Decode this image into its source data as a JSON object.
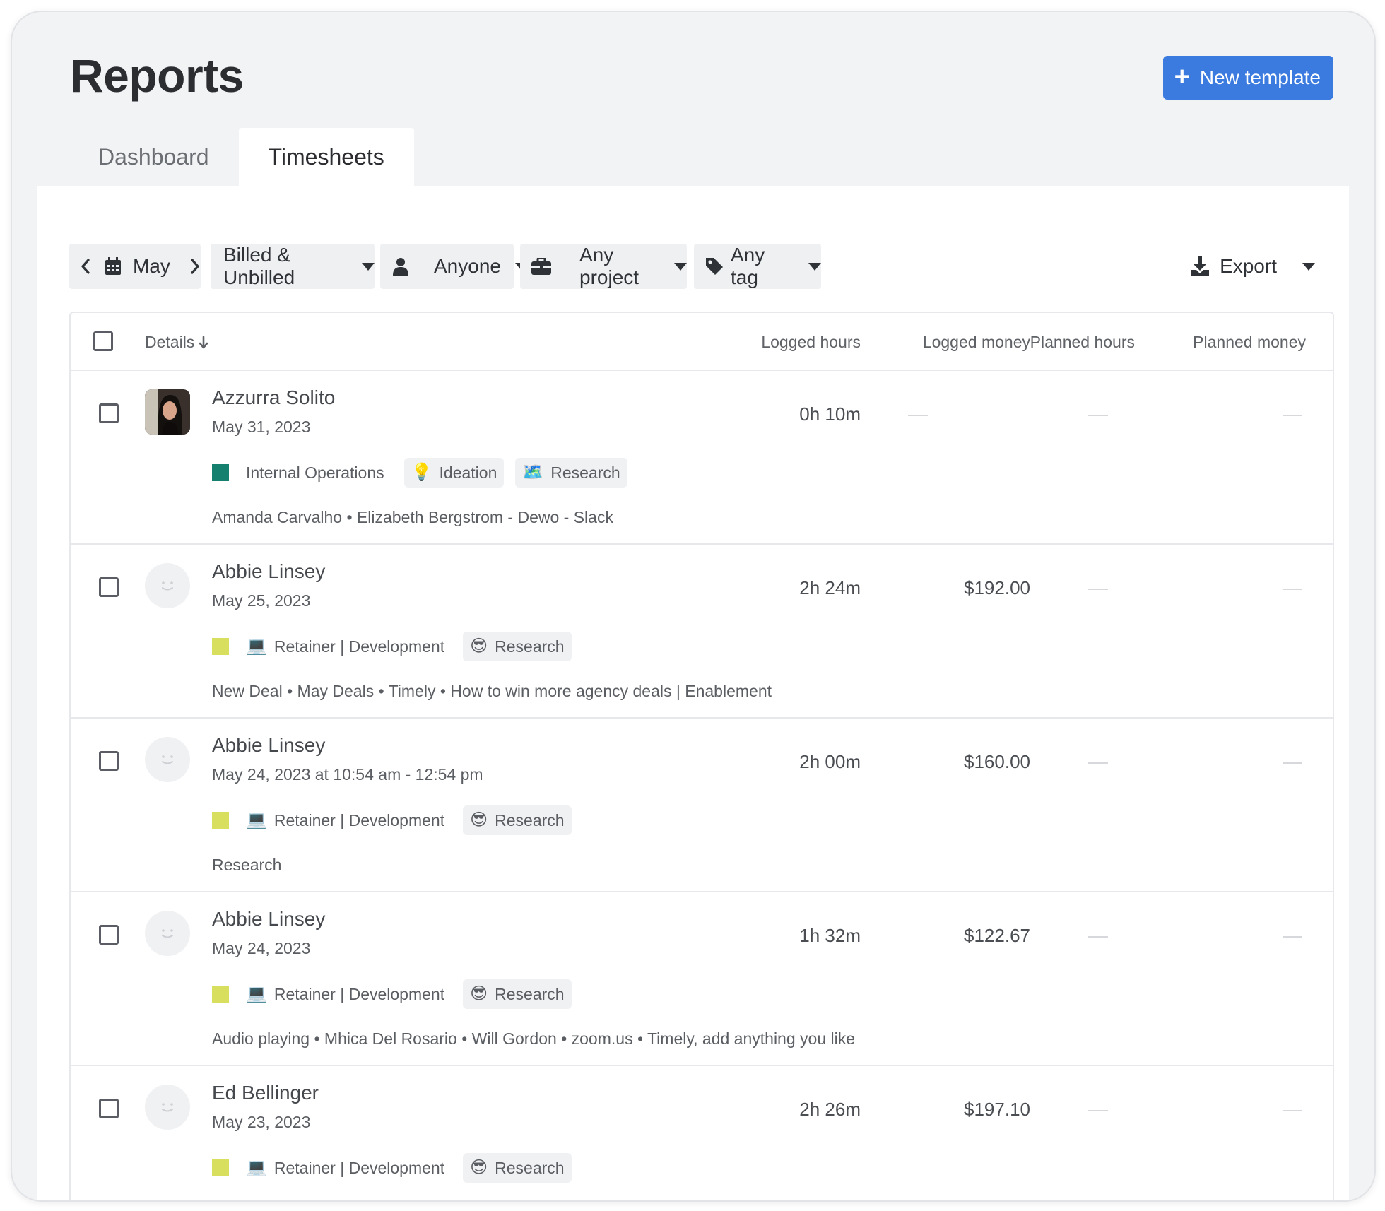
{
  "page": {
    "title": "Reports",
    "new_template_label": "New template"
  },
  "tabs": [
    {
      "label": "Dashboard",
      "active": false
    },
    {
      "label": "Timesheets",
      "active": true
    }
  ],
  "filters": {
    "period": "May",
    "billing": "Billed & Unbilled",
    "person": "Anyone",
    "project": "Any project",
    "tag": "Any tag",
    "export_label": "Export"
  },
  "table": {
    "columns": {
      "details": "Details",
      "logged_hours": "Logged hours",
      "logged_money": "Logged money",
      "planned_hours": "Planned hours",
      "planned_money": "Planned money"
    },
    "rows": [
      {
        "name": "Azzurra Solito",
        "date": "May 31, 2023",
        "logged_hours": "0h 10m",
        "logged_money": "",
        "project": "Internal Operations",
        "project_color": "#16806f",
        "tags": [
          {
            "icon": "lightbulb-icon",
            "label": "Ideation"
          },
          {
            "icon": "map-icon",
            "label": "Research"
          }
        ],
        "description": "Amanda Carvalho • Elizabeth Bergstrom - Dewo - Slack"
      },
      {
        "name": "Abbie Linsey",
        "date": "May 25, 2023",
        "logged_hours": "2h 24m",
        "logged_money": "$192.00",
        "project": "Retainer | Development",
        "project_color": "#d8df5f",
        "tags": [
          {
            "icon": "sunglasses-face-icon",
            "label": "Research"
          }
        ],
        "description": "New Deal • May Deals • Timely • How to win more agency deals | Enablement"
      },
      {
        "name": "Abbie Linsey",
        "date": "May 24, 2023 at 10:54 am - 12:54 pm",
        "logged_hours": "2h 00m",
        "logged_money": "$160.00",
        "project": "Retainer | Development",
        "project_color": "#d8df5f",
        "tags": [
          {
            "icon": "sunglasses-face-icon",
            "label": "Research"
          }
        ],
        "description": "Research"
      },
      {
        "name": "Abbie Linsey",
        "date": "May 24, 2023",
        "logged_hours": "1h 32m",
        "logged_money": "$122.67",
        "project": "Retainer | Development",
        "project_color": "#d8df5f",
        "tags": [
          {
            "icon": "sunglasses-face-icon",
            "label": "Research"
          }
        ],
        "description": "Audio playing • Mhica Del Rosario • Will Gordon • zoom.us • Timely, add anything you like"
      },
      {
        "name": "Ed Bellinger",
        "date": "May 23, 2023",
        "logged_hours": "2h 26m",
        "logged_money": "$197.10",
        "project": "Retainer | Development",
        "project_color": "#d8df5f",
        "tags": [
          {
            "icon": "sunglasses-face-icon",
            "label": "Research"
          }
        ],
        "description": ""
      }
    ]
  },
  "colors": {
    "accent": "#3b7be0",
    "background": "#f2f3f5"
  }
}
